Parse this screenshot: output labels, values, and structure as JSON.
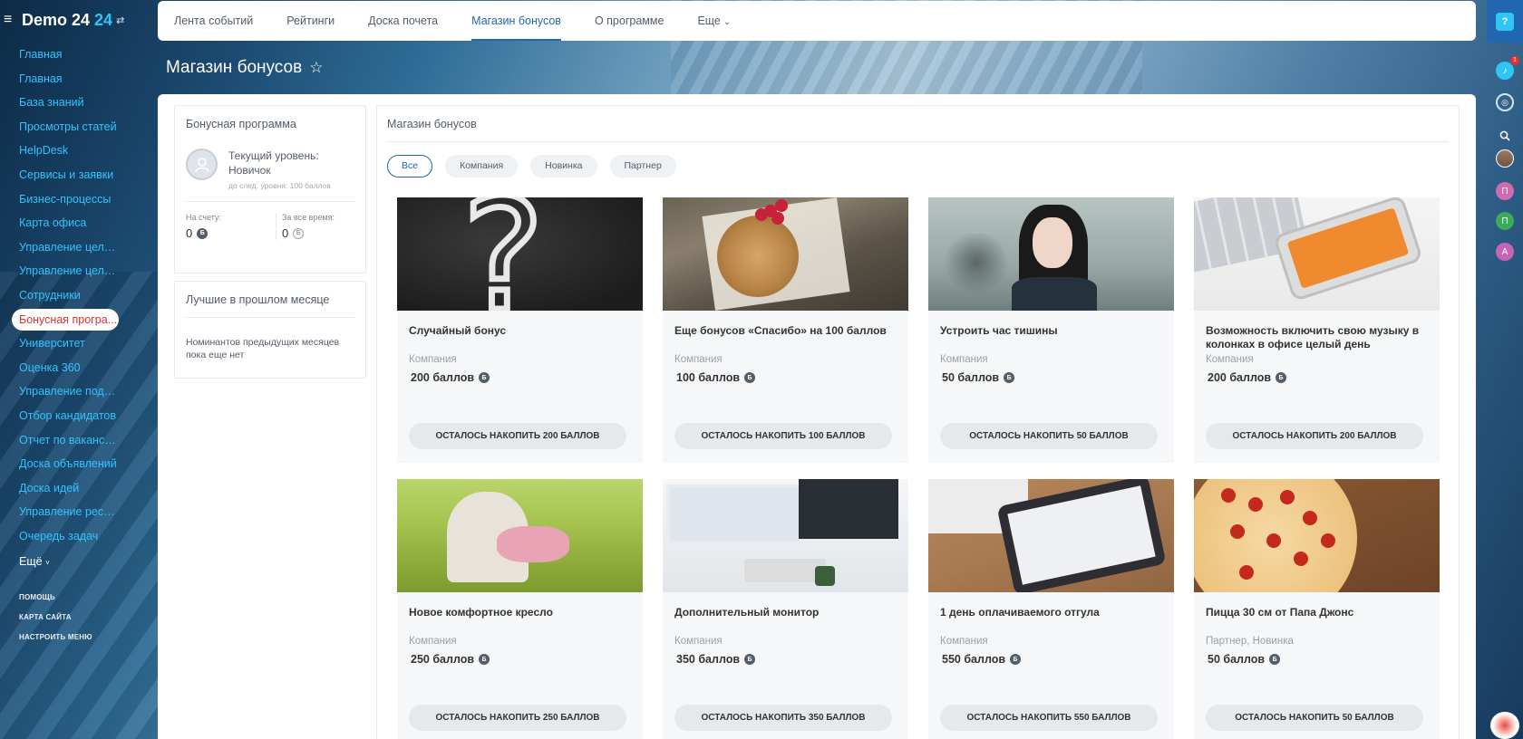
{
  "app": {
    "name": "Demo 24",
    "number": "24"
  },
  "sidebar": {
    "items": [
      {
        "label": "Главная"
      },
      {
        "label": "Главная"
      },
      {
        "label": "База знаний"
      },
      {
        "label": "Просмотры статей"
      },
      {
        "label": "HelpDesk"
      },
      {
        "label": "Сервисы и заявки"
      },
      {
        "label": "Бизнес-процессы"
      },
      {
        "label": "Карта офиса"
      },
      {
        "label": "Управление целями"
      },
      {
        "label": "Управление целям..."
      },
      {
        "label": "Сотрудники"
      },
      {
        "label": "Бонусная програ...",
        "active": true
      },
      {
        "label": "Университет"
      },
      {
        "label": "Оценка 360"
      },
      {
        "label": "Управление подбо..."
      },
      {
        "label": "Отбор кандидатов"
      },
      {
        "label": "Отчет по вакансиям"
      },
      {
        "label": "Доска объявлений"
      },
      {
        "label": "Доска идей"
      },
      {
        "label": "Управление ресур..."
      },
      {
        "label": "Очередь задач"
      }
    ],
    "more_label": "Ещё",
    "more_chev": "˅",
    "footer_links": [
      "ПОМОЩЬ",
      "КАРТА САЙТА",
      "НАСТРОИТЬ МЕНЮ"
    ]
  },
  "topnav": {
    "tabs": [
      "Лента событий",
      "Рейтинги",
      "Доска почета",
      "Магазин бонусов",
      "О программе",
      "Еще"
    ],
    "active_index": 3
  },
  "page": {
    "title": "Магазин бонусов"
  },
  "bonus_program": {
    "title": "Бонусная программа",
    "level_label": "Текущий уровень: Новичок",
    "next_level": "до след. уровня: 100 баллов",
    "balance_label": "На счету:",
    "balance_value": "0",
    "total_label": "За все время:",
    "total_value": "0"
  },
  "best_last_month": {
    "title": "Лучшие в прошлом месяце",
    "text": "Номинантов предыдущих месяцев пока еще нет"
  },
  "shop": {
    "title": "Магазин бонусов",
    "filters": [
      "Все",
      "Компания",
      "Новинка",
      "Партнер"
    ],
    "active_filter": 0,
    "coin_glyph": "Б",
    "items": [
      {
        "name": "Случайный бонус",
        "category": "Компания",
        "price": "200 баллов",
        "button": "ОСТАЛОСЬ НАКОПИТЬ 200 БАЛЛОВ",
        "image": "question-mark"
      },
      {
        "name": "Еще бонусов «Спасибо» на 100 баллов",
        "category": "Компания",
        "price": "100 баллов",
        "button": "ОСТАЛОСЬ НАКОПИТЬ 100 БАЛЛОВ",
        "image": "gift"
      },
      {
        "name": "Устроить час тишины",
        "category": "Компания",
        "price": "50 баллов",
        "button": "ОСТАЛОСЬ НАКОПИТЬ 50 БАЛЛОВ",
        "image": "silence"
      },
      {
        "name": "Возможность включить свою музыку в колонках в офисе целый день",
        "category": "Компания",
        "price": "200 баллов",
        "button": "ОСТАЛОСЬ НАКОПИТЬ 200 БАЛЛОВ",
        "image": "phone"
      },
      {
        "name": "Новое комфортное кресло",
        "category": "Компания",
        "price": "250 баллов",
        "button": "ОСТАЛОСЬ НАКОПИТЬ 250 БАЛЛОВ",
        "image": "chair"
      },
      {
        "name": "Дополнительный монитор",
        "category": "Компания",
        "price": "350 баллов",
        "button": "ОСТАЛОСЬ НАКОПИТЬ 350 БАЛЛОВ",
        "image": "monitor"
      },
      {
        "name": "1 день оплачиваемого отгула",
        "category": "Компания",
        "price": "550 баллов",
        "button": "ОСТАЛОСЬ НАКОПИТЬ 550 БАЛЛОВ",
        "image": "tablet"
      },
      {
        "name": "Пицца 30 см от Папа Джонс",
        "category": "Партнер, Новинка",
        "price": "50 баллов",
        "button": "ОСТАЛОСЬ НАКОПИТЬ 50 БАЛЛОВ",
        "image": "pizza"
      }
    ]
  },
  "rail": {
    "help_label": "?",
    "notifications_count": "1",
    "avatars": [
      "П",
      "П",
      "А"
    ]
  },
  "colors": {
    "accent": "#2067b0",
    "link": "#33c3ff",
    "active_menu_text": "#e0312c"
  }
}
